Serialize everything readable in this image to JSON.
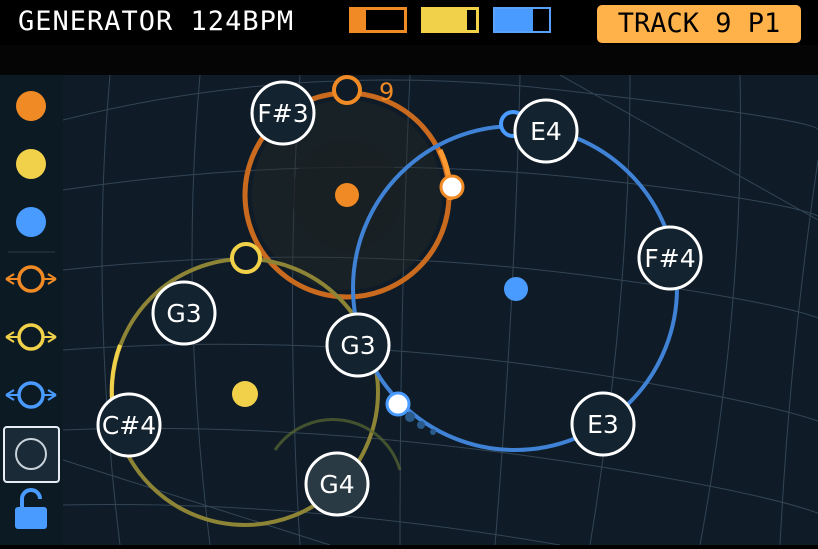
{
  "header": {
    "title": "GENERATOR 124BPM",
    "track_badge": "TRACK 9 P1"
  },
  "colors": {
    "orange": "#f08a24",
    "yellow": "#f2d14a",
    "blue": "#4a9bff",
    "badge": "#ffb24a"
  },
  "sidebar": {
    "items": [
      {
        "name": "orange-dot-icon"
      },
      {
        "name": "yellow-dot-icon"
      },
      {
        "name": "blue-dot-icon"
      },
      {
        "name": "orange-ring-arrows-icon"
      },
      {
        "name": "yellow-ring-arrows-icon"
      },
      {
        "name": "blue-ring-arrows-icon"
      },
      {
        "name": "empty-ring-icon",
        "selected": true
      },
      {
        "name": "unlock-icon"
      }
    ]
  },
  "canvas": {
    "orange_count": "9",
    "notes": {
      "orange_1": "F#3",
      "blue_1": "E4",
      "blue_2": "F#4",
      "blue_3": "E3",
      "shared": "G3",
      "yellow_1": "G3",
      "yellow_2": "C#4",
      "yellow_3": "G4"
    }
  }
}
